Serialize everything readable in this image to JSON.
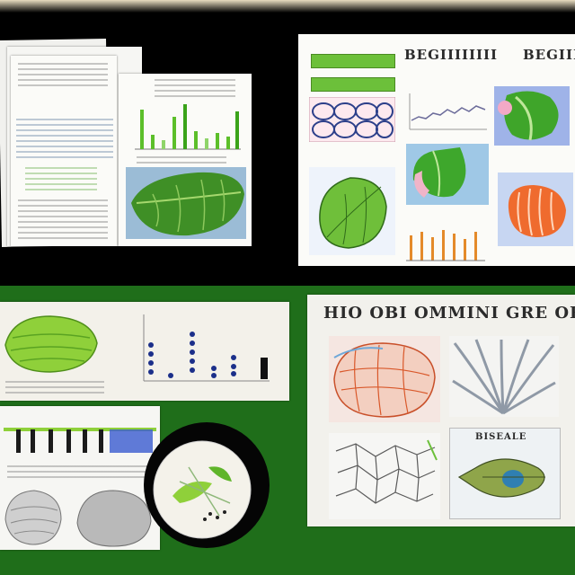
{
  "scene": {
    "background": {
      "top": "#000000",
      "bottom": "#1f6e1a",
      "table_edge": "#c8b48a"
    },
    "accent_green": "#5cbf2a",
    "accent_blue": "#1b2f8a",
    "accent_orange": "#e2592a"
  },
  "top_right_board": {
    "heading_left": "BEGIIIIIIII",
    "heading_right": "BEGIII"
  },
  "bottom_right_board": {
    "heading": "HIO OBI OMMINI GRE ORC DEPIBIC",
    "panel_caption": "BISEALE"
  }
}
